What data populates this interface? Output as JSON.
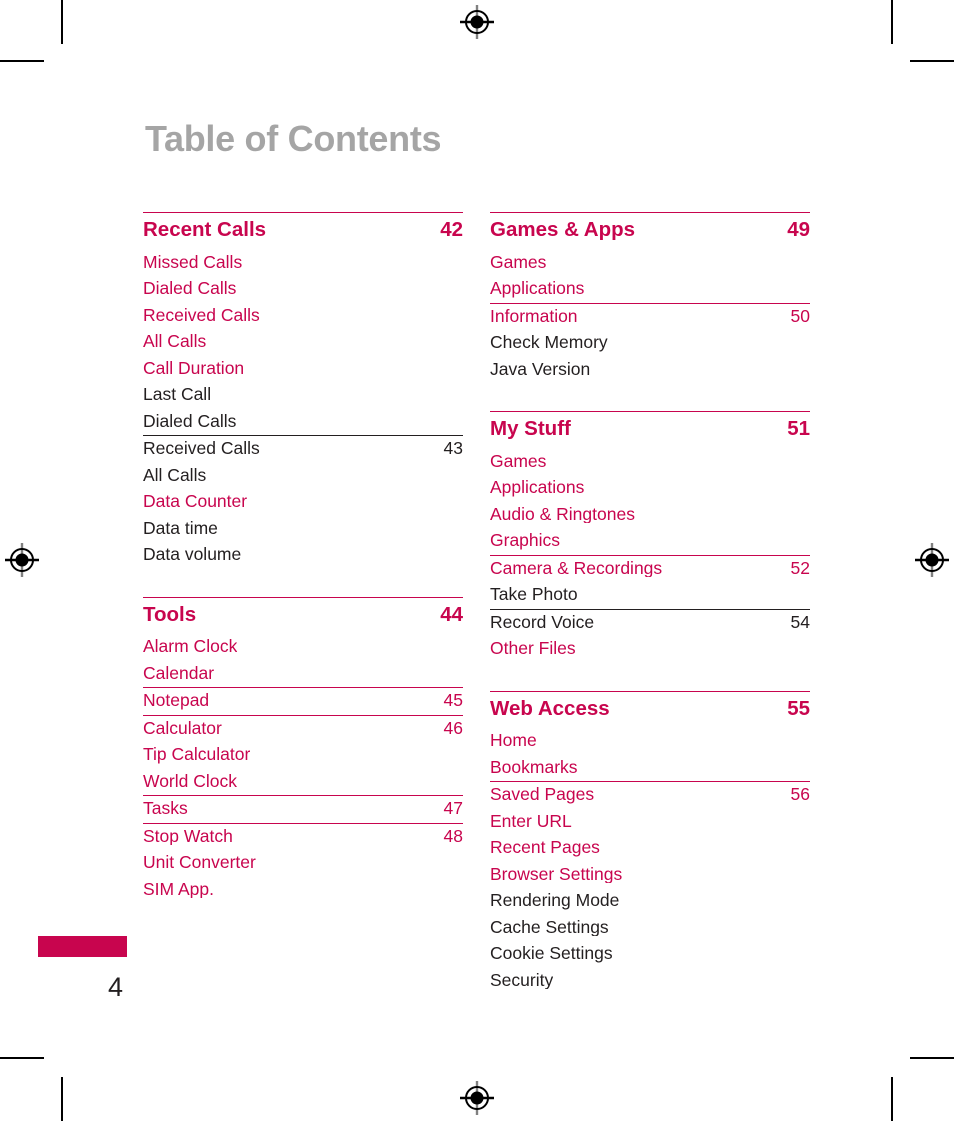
{
  "document": {
    "title": "Table of Contents",
    "folio": "4"
  },
  "colors": {
    "accent": "#c8054e",
    "title_gray": "#a5a5a5",
    "body_dark": "#231f20"
  },
  "marks": {
    "registration_icon": "registration-target-icon",
    "crop_icon": "crop-mark-icon"
  },
  "columns": [
    {
      "id": "left",
      "sections": [
        {
          "heading": {
            "label": "Recent Calls",
            "page": "42",
            "level": 0,
            "rule": "crimson"
          },
          "entries": [
            {
              "label": "Missed Calls",
              "page": "",
              "level": 1,
              "rule": "none"
            },
            {
              "label": "Dialed Calls",
              "page": "",
              "level": 1,
              "rule": "none"
            },
            {
              "label": "Received Calls",
              "page": "",
              "level": 1,
              "rule": "none"
            },
            {
              "label": "All Calls",
              "page": "",
              "level": 1,
              "rule": "none"
            },
            {
              "label": "Call Duration",
              "page": "",
              "level": 1,
              "rule": "none"
            },
            {
              "label": "Last Call",
              "page": "",
              "level": 2,
              "rule": "none"
            },
            {
              "label": "Dialed Calls",
              "page": "",
              "level": 2,
              "rule": "none"
            },
            {
              "label": "Received Calls",
              "page": "43",
              "level": 2,
              "rule": "dark"
            },
            {
              "label": "All Calls",
              "page": "",
              "level": 2,
              "rule": "none"
            },
            {
              "label": "Data Counter",
              "page": "",
              "level": 1,
              "rule": "none"
            },
            {
              "label": "Data time",
              "page": "",
              "level": 2,
              "rule": "none"
            },
            {
              "label": "Data volume",
              "page": "",
              "level": 2,
              "rule": "none"
            }
          ]
        },
        {
          "heading": {
            "label": "Tools",
            "page": "44",
            "level": 0,
            "rule": "crimson"
          },
          "entries": [
            {
              "label": "Alarm Clock",
              "page": "",
              "level": 1,
              "rule": "none"
            },
            {
              "label": "Calendar",
              "page": "",
              "level": 1,
              "rule": "none"
            },
            {
              "label": "Notepad",
              "page": "45",
              "level": 1,
              "rule": "crimson"
            },
            {
              "label": "Calculator",
              "page": "46",
              "level": 1,
              "rule": "crimson"
            },
            {
              "label": "Tip Calculator",
              "page": "",
              "level": 1,
              "rule": "none"
            },
            {
              "label": "World Clock",
              "page": "",
              "level": 1,
              "rule": "none"
            },
            {
              "label": "Tasks",
              "page": "47",
              "level": 1,
              "rule": "crimson"
            },
            {
              "label": "Stop Watch",
              "page": "48",
              "level": 1,
              "rule": "crimson"
            },
            {
              "label": "Unit Converter",
              "page": "",
              "level": 1,
              "rule": "none"
            },
            {
              "label": "SIM App.",
              "page": "",
              "level": 1,
              "rule": "none"
            }
          ]
        }
      ]
    },
    {
      "id": "right",
      "sections": [
        {
          "heading": {
            "label": "Games & Apps",
            "page": "49",
            "level": 0,
            "rule": "crimson"
          },
          "entries": [
            {
              "label": "Games",
              "page": "",
              "level": 1,
              "rule": "none"
            },
            {
              "label": "Applications",
              "page": "",
              "level": 1,
              "rule": "none"
            },
            {
              "label": "Information",
              "page": "50",
              "level": 1,
              "rule": "crimson"
            },
            {
              "label": "Check Memory",
              "page": "",
              "level": 2,
              "rule": "none"
            },
            {
              "label": "Java Version",
              "page": "",
              "level": 2,
              "rule": "none"
            }
          ]
        },
        {
          "heading": {
            "label": "My Stuff",
            "page": "51",
            "level": 0,
            "rule": "crimson"
          },
          "entries": [
            {
              "label": "Games",
              "page": "",
              "level": 1,
              "rule": "none"
            },
            {
              "label": "Applications",
              "page": "",
              "level": 1,
              "rule": "none"
            },
            {
              "label": "Audio & Ringtones",
              "page": "",
              "level": 1,
              "rule": "none"
            },
            {
              "label": "Graphics",
              "page": "",
              "level": 1,
              "rule": "none"
            },
            {
              "label": "Camera & Recordings",
              "page": "52",
              "level": 1,
              "rule": "crimson"
            },
            {
              "label": "Take Photo",
              "page": "",
              "level": 2,
              "rule": "none"
            },
            {
              "label": "Record Voice",
              "page": "54",
              "level": 2,
              "rule": "dark"
            },
            {
              "label": "Other Files",
              "page": "",
              "level": 1,
              "rule": "none"
            }
          ]
        },
        {
          "heading": {
            "label": "Web Access",
            "page": "55",
            "level": 0,
            "rule": "crimson"
          },
          "entries": [
            {
              "label": "Home",
              "page": "",
              "level": 1,
              "rule": "none"
            },
            {
              "label": "Bookmarks",
              "page": "",
              "level": 1,
              "rule": "none"
            },
            {
              "label": "Saved Pages",
              "page": "56",
              "level": 1,
              "rule": "crimson"
            },
            {
              "label": "Enter URL",
              "page": "",
              "level": 1,
              "rule": "none"
            },
            {
              "label": "Recent Pages",
              "page": "",
              "level": 1,
              "rule": "none"
            },
            {
              "label": "Browser Settings",
              "page": "",
              "level": 1,
              "rule": "none"
            },
            {
              "label": "Rendering Mode",
              "page": "",
              "level": 2,
              "rule": "none"
            },
            {
              "label": "Cache Settings",
              "page": "",
              "level": 2,
              "rule": "none"
            },
            {
              "label": "Cookie Settings",
              "page": "",
              "level": 2,
              "rule": "none"
            },
            {
              "label": "Security",
              "page": "",
              "level": 2,
              "rule": "none"
            }
          ]
        }
      ]
    }
  ]
}
